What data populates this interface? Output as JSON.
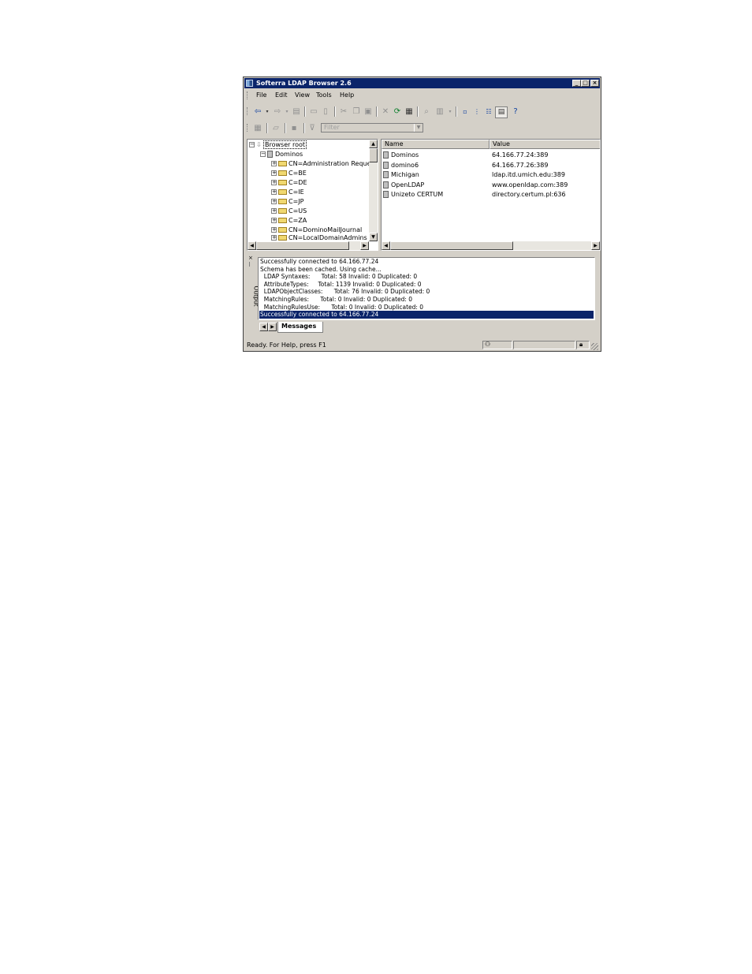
{
  "window": {
    "title": "Softerra LDAP Browser 2.6",
    "controls": {
      "minimize": "_",
      "maximize": "□",
      "close": "×"
    }
  },
  "menu": [
    "File",
    "Edit",
    "View",
    "Tools",
    "Help"
  ],
  "toolbar": {
    "back_icon": "back-arrow-icon",
    "forward_icon": "forward-arrow-icon",
    "filter_placeholder": "Filter"
  },
  "tree": {
    "root": "Browser root",
    "server": "Dominos",
    "children": [
      "CN=Administration Reque:",
      "C=BE",
      "C=DE",
      "C=IE",
      "C=JP",
      "C=US",
      "C=ZA",
      "CN=DominoMailJournal",
      "CN=LocalDomainAdmins"
    ]
  },
  "list": {
    "columns": [
      "Name",
      "Value"
    ],
    "rows": [
      {
        "name": "Dominos",
        "value": "64.166.77.24:389"
      },
      {
        "name": "domino6",
        "value": "64.166.77.26:389"
      },
      {
        "name": "Michigan",
        "value": "ldap.itd.umich.edu:389"
      },
      {
        "name": "OpenLDAP",
        "value": "www.openldap.com:389"
      },
      {
        "name": "Unizeto CERTUM",
        "value": "directory.certum.pl:636"
      }
    ]
  },
  "output": {
    "side_label": "Output",
    "messages": [
      "Successfully connected to 64.166.77.24",
      "Schema has been cached. Using cache...",
      "  LDAP Syntaxes:      Total: 58 Invalid: 0 Duplicated: 0",
      "  AttributeTypes:     Total: 1139 Invalid: 0 Duplicated: 0",
      "  LDAPObjectClasses:      Total: 76 Invalid: 0 Duplicated: 0",
      "  MatchingRules:      Total: 0 Invalid: 0 Duplicated: 0",
      "  MatchingRulesUse:      Total: 0 Invalid: 0 Duplicated: 0",
      "Successfully connected to 64.166.77.24"
    ],
    "tab": "Messages"
  },
  "status": {
    "text": "Ready. For Help, press F1"
  }
}
